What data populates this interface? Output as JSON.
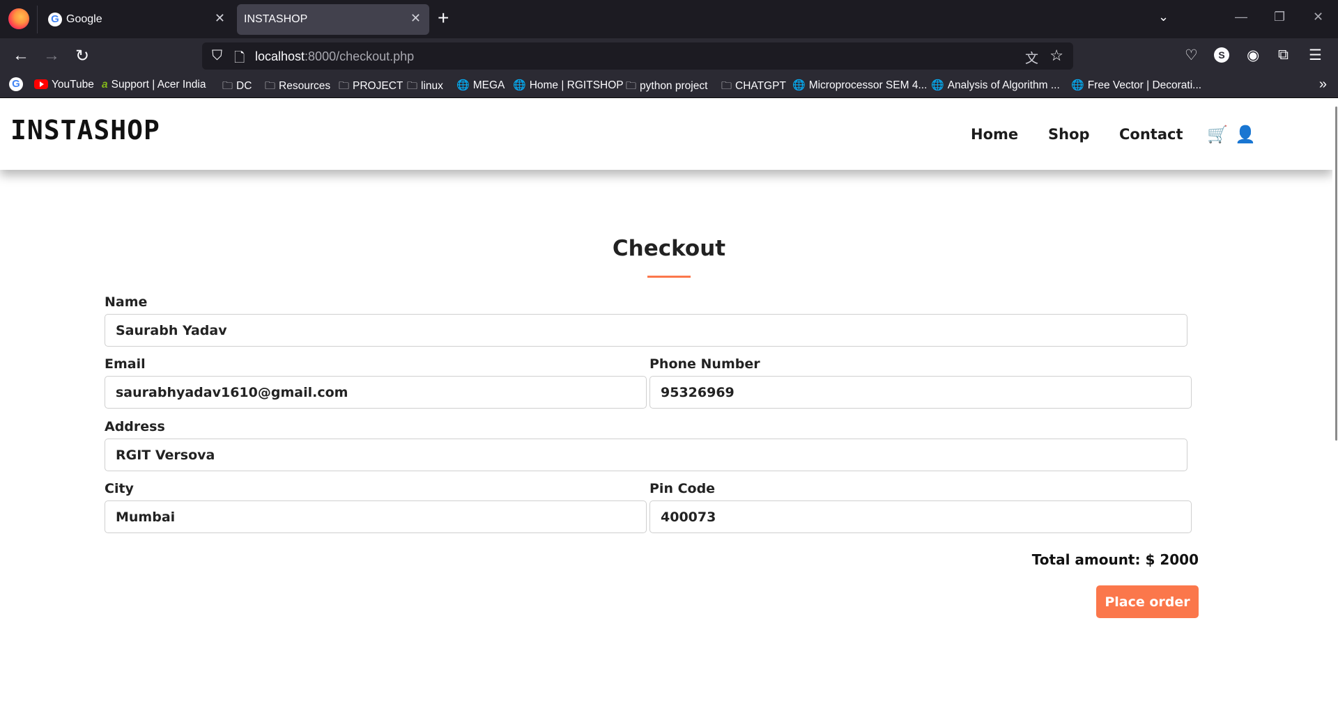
{
  "browser": {
    "tabs": [
      {
        "title": "Google",
        "active": false
      },
      {
        "title": "INSTASHOP",
        "active": true
      }
    ],
    "url": {
      "host": "localhost",
      "rest": ":8000/checkout.php"
    },
    "bookmarks": [
      {
        "label": "YouTube",
        "icon": "youtube-icon"
      },
      {
        "label": "Support | Acer India",
        "icon": "acer-icon"
      },
      {
        "label": "DC",
        "icon": "folder-icon"
      },
      {
        "label": "Resources",
        "icon": "folder-icon"
      },
      {
        "label": "PROJECT",
        "icon": "folder-icon"
      },
      {
        "label": "linux",
        "icon": "folder-icon"
      },
      {
        "label": "MEGA",
        "icon": "globe-icon"
      },
      {
        "label": "Home | RGITSHOP",
        "icon": "globe-icon"
      },
      {
        "label": "python project",
        "icon": "folder-icon"
      },
      {
        "label": "CHATGPT",
        "icon": "folder-icon"
      },
      {
        "label": "Microprocessor SEM 4...",
        "icon": "globe-icon"
      },
      {
        "label": "Analysis of Algorithm ...",
        "icon": "globe-icon"
      },
      {
        "label": "Free Vector | Decorati...",
        "icon": "globe-icon"
      }
    ]
  },
  "site": {
    "brand": "INSTASHOP",
    "nav": [
      "Home",
      "Shop",
      "Contact"
    ],
    "accent_color": "#fb774b"
  },
  "checkout": {
    "title": "Checkout",
    "fields": {
      "name": {
        "label": "Name",
        "value": "Saurabh Yadav"
      },
      "email": {
        "label": "Email",
        "value": "saurabhyadav1610@gmail.com"
      },
      "phone": {
        "label": "Phone Number",
        "value": "95326969"
      },
      "address": {
        "label": "Address",
        "value": "RGIT Versova"
      },
      "city": {
        "label": "City",
        "value": "Mumbai"
      },
      "pincode": {
        "label": "Pin Code",
        "value": "400073"
      }
    },
    "total_label": "Total amount: $ 2000",
    "place_order_label": "Place order"
  }
}
